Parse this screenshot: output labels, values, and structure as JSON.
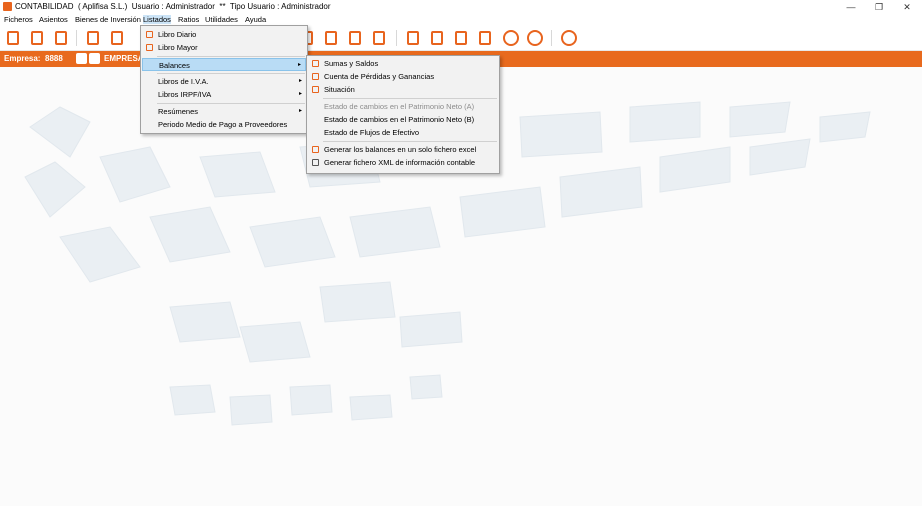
{
  "window": {
    "title": "CONTABILIDAD  ( Aplifisa S.L.)  Usuario : Administrador  **  Tipo Usuario : Administrador",
    "buttons": [
      "—",
      "❐",
      "✕"
    ]
  },
  "menubar": [
    "Ficheros",
    "Asientos",
    "Bienes de Inversión",
    "Listados",
    "Ratios",
    "Utilidades",
    "Ayuda"
  ],
  "orange_bar": {
    "empresa_label": "Empresa:",
    "empresa_code": "8888",
    "empresa_name": "EMPRESA"
  },
  "listados_menu": [
    "Libro Diario",
    "Libro Mayor",
    "Balances",
    "Libros de I.V.A.",
    "Libros IRPF/IVA",
    "Resúmenes",
    "Periodo Medio de Pago a Proveedores"
  ],
  "balances_menu": [
    "Sumas y Saldos",
    "Cuenta de Pérdidas y Ganancias",
    "Situación",
    "Estado de cambios en el  Patrimonio Neto (A)",
    "Estado de cambios en el  Patrimonio Neto (B)",
    "Estado de Flujos de Efectivo",
    "Generar los balances en un solo fichero excel",
    "Generar fichero XML de información contable"
  ],
  "colors": {
    "accent": "#e86a1e",
    "highlight": "#b9dcf5"
  },
  "submenu_arrow": "▸"
}
